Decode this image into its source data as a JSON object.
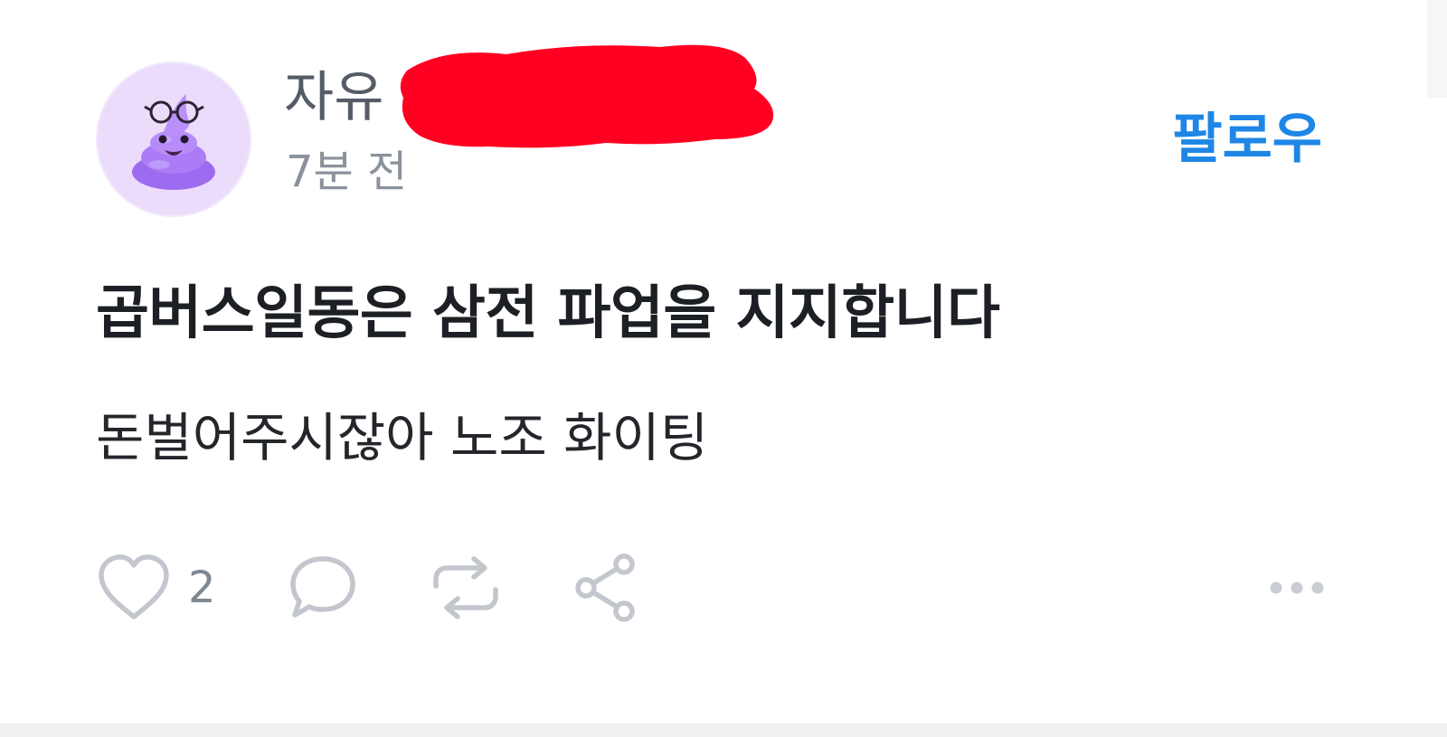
{
  "post": {
    "author": {
      "name": "자유",
      "avatar_icon": "purple-poop-emoji-icon",
      "avatar_bg": "#ecdcfc"
    },
    "timestamp": "7분 전",
    "follow_label": "팔로우",
    "title": "곱버스일동은 삼전 파업을 지지합니다",
    "body": "돈벌어주시잖아 노조 화이팅",
    "actions": {
      "like_icon": "heart-icon",
      "like_count": "2",
      "comment_icon": "comment-bubble-icon",
      "repost_icon": "repost-icon",
      "share_icon": "share-icon",
      "more_icon": "more-dots-icon"
    }
  },
  "colors": {
    "accent": "#1e86e6",
    "redaction": "#ff0022",
    "icon": "#c3c7cd"
  }
}
